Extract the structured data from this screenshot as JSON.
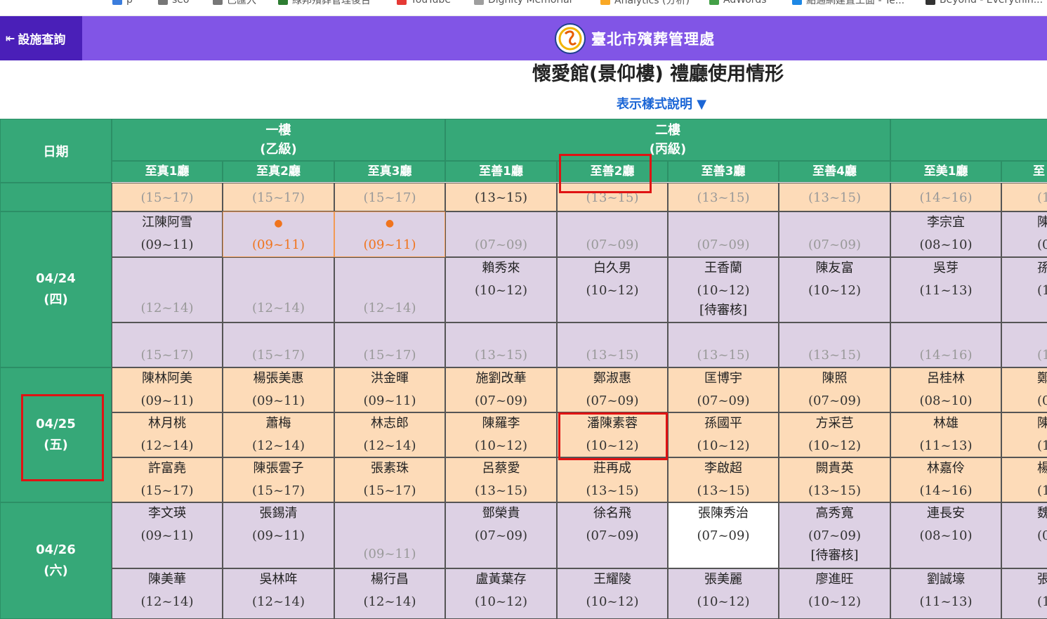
{
  "bookmarks": [
    {
      "label": "p",
      "color": "#3b7ddd"
    },
    {
      "label": "seo",
      "color": "#777777"
    },
    {
      "label": "已匯入",
      "color": "#777777"
    },
    {
      "label": "綠邦殯葬管理後台",
      "color": "#2e7d32"
    },
    {
      "label": "YouTube",
      "color": "#e53935"
    },
    {
      "label": "Dignity Memorial",
      "color": "#9e9e9e"
    },
    {
      "label": "Analytics (分析)",
      "color": "#f9a825"
    },
    {
      "label": "AdWords",
      "color": "#43a047"
    },
    {
      "label": "點通網建置工面 - Te...",
      "color": "#1e88e5"
    },
    {
      "label": "Beyond - Everythin...",
      "color": "#333333"
    }
  ],
  "header": {
    "back_label": "設施查詢",
    "back_icon": "back-arrow-icon",
    "brand": "臺北市殯葬管理處",
    "logo_icon": "agency-logo-icon"
  },
  "page": {
    "title": "懷愛館(景仰樓) 禮廳使用情形",
    "legend_toggle": "表示樣式說明 ▼"
  },
  "table": {
    "date_header": "日期",
    "floors": [
      {
        "label": "一樓",
        "sub": "(乙級)"
      },
      {
        "label": "二樓",
        "sub": "(丙級)"
      }
    ],
    "halls": [
      "至真1廳",
      "至真2廳",
      "至真3廳",
      "至善1廳",
      "至善2廳",
      "至善3廳",
      "至善4廳",
      "至美1廳",
      "至"
    ],
    "dates": [
      {
        "date": "04/24",
        "weekday": "(四)"
      },
      {
        "date": "04/25",
        "weekday": "(五)"
      },
      {
        "date": "04/26",
        "weekday": "(六)"
      }
    ],
    "rows": [
      {
        "cells": [
          {
            "time": "(15~17)",
            "state": "avail",
            "bg": "orange"
          },
          {
            "time": "(15~17)",
            "state": "avail",
            "bg": "orange"
          },
          {
            "time": "(15~17)",
            "state": "avail",
            "bg": "orange"
          },
          {
            "time": "(13~15)",
            "bg": "orange"
          },
          {
            "time": "(13~15)",
            "state": "avail",
            "bg": "orange"
          },
          {
            "time": "(13~15)",
            "state": "avail",
            "bg": "orange"
          },
          {
            "time": "(13~15)",
            "state": "avail",
            "bg": "orange"
          },
          {
            "time": "(14~16)",
            "state": "avail",
            "bg": "orange"
          },
          {
            "time": "(1",
            "state": "avail",
            "bg": "orange"
          }
        ]
      },
      {
        "cells": [
          {
            "name": "江陳阿雪",
            "time": "(09~11)",
            "bg": "lilac"
          },
          {
            "time": "(09~11)",
            "state": "sel",
            "bg": "sel"
          },
          {
            "time": "(09~11)",
            "state": "sel",
            "bg": "sel"
          },
          {
            "time": "(07~09)",
            "state": "avail",
            "bg": "lilac"
          },
          {
            "time": "(07~09)",
            "state": "avail",
            "bg": "lilac"
          },
          {
            "time": "(07~09)",
            "state": "avail",
            "bg": "lilac"
          },
          {
            "time": "(07~09)",
            "state": "avail",
            "bg": "lilac"
          },
          {
            "name": "李宗宜",
            "time": "(08~10)",
            "bg": "lilac"
          },
          {
            "name": "陳",
            "time": "(0",
            "bg": "lilac"
          }
        ]
      },
      {
        "cells": [
          {
            "time": "(12~14)",
            "state": "avail",
            "bg": "lilac"
          },
          {
            "time": "(12~14)",
            "state": "avail",
            "bg": "lilac"
          },
          {
            "time": "(12~14)",
            "state": "avail",
            "bg": "lilac"
          },
          {
            "name": "賴秀來",
            "time": "(10~12)",
            "bg": "lilac"
          },
          {
            "name": "白久男",
            "time": "(10~12)",
            "bg": "lilac"
          },
          {
            "name": "王香蘭",
            "time": "(10~12)",
            "status": "[待審核]",
            "bg": "lilac"
          },
          {
            "name": "陳友富",
            "time": "(10~12)",
            "bg": "lilac"
          },
          {
            "name": "吳芽",
            "time": "(11~13)",
            "bg": "lilac"
          },
          {
            "name": "孫",
            "time": "(1",
            "bg": "lilac"
          }
        ]
      },
      {
        "cells": [
          {
            "time": "(15~17)",
            "state": "avail",
            "bg": "lilac"
          },
          {
            "time": "(15~17)",
            "state": "avail",
            "bg": "lilac"
          },
          {
            "time": "(15~17)",
            "state": "avail",
            "bg": "lilac"
          },
          {
            "time": "(13~15)",
            "state": "avail",
            "bg": "lilac"
          },
          {
            "time": "(13~15)",
            "state": "avail",
            "bg": "lilac"
          },
          {
            "time": "(13~15)",
            "state": "avail",
            "bg": "lilac"
          },
          {
            "time": "(13~15)",
            "state": "avail",
            "bg": "lilac"
          },
          {
            "time": "(14~16)",
            "state": "avail",
            "bg": "lilac"
          },
          {
            "time": "(1",
            "state": "avail",
            "bg": "lilac"
          }
        ]
      },
      {
        "cells": [
          {
            "name": "陳林阿美",
            "time": "(09~11)",
            "bg": "orange"
          },
          {
            "name": "楊張美惠",
            "time": "(09~11)",
            "bg": "orange"
          },
          {
            "name": "洪金暉",
            "time": "(09~11)",
            "bg": "orange"
          },
          {
            "name": "施劉改華",
            "time": "(07~09)",
            "bg": "orange"
          },
          {
            "name": "鄭淑惠",
            "time": "(07~09)",
            "bg": "orange"
          },
          {
            "name": "匡博宇",
            "time": "(07~09)",
            "bg": "orange"
          },
          {
            "name": "陳照",
            "time": "(07~09)",
            "bg": "orange"
          },
          {
            "name": "呂桂林",
            "time": "(08~10)",
            "bg": "orange"
          },
          {
            "name": "鄭",
            "time": "(0",
            "bg": "orange"
          }
        ]
      },
      {
        "cells": [
          {
            "name": "林月桃",
            "time": "(12~14)",
            "bg": "orange"
          },
          {
            "name": "蕭梅",
            "time": "(12~14)",
            "bg": "orange"
          },
          {
            "name": "林志郎",
            "time": "(12~14)",
            "bg": "orange"
          },
          {
            "name": "陳羅李",
            "time": "(10~12)",
            "bg": "orange"
          },
          {
            "name": "潘陳素蓉",
            "time": "(10~12)",
            "bg": "orange"
          },
          {
            "name": "孫國平",
            "time": "(10~12)",
            "bg": "orange"
          },
          {
            "name": "方采芑",
            "time": "(10~12)",
            "bg": "orange"
          },
          {
            "name": "林雄",
            "time": "(11~13)",
            "bg": "orange"
          },
          {
            "name": "陳",
            "time": "(1",
            "bg": "orange"
          }
        ]
      },
      {
        "cells": [
          {
            "name": "許富堯",
            "time": "(15~17)",
            "bg": "orange"
          },
          {
            "name": "陳張雲子",
            "time": "(15~17)",
            "bg": "orange"
          },
          {
            "name": "張素珠",
            "time": "(15~17)",
            "bg": "orange"
          },
          {
            "name": "呂蔡愛",
            "time": "(13~15)",
            "bg": "orange"
          },
          {
            "name": "莊再成",
            "time": "(13~15)",
            "bg": "orange"
          },
          {
            "name": "李啟超",
            "time": "(13~15)",
            "bg": "orange"
          },
          {
            "name": "闕貴英",
            "time": "(13~15)",
            "bg": "orange"
          },
          {
            "name": "林嘉伶",
            "time": "(14~16)",
            "bg": "orange"
          },
          {
            "name": "楊",
            "time": "(1",
            "bg": "orange"
          }
        ]
      },
      {
        "cells": [
          {
            "name": "李文瑛",
            "time": "(09~11)",
            "bg": "lilac"
          },
          {
            "name": "張錫清",
            "time": "(09~11)",
            "bg": "lilac"
          },
          {
            "time": "(09~11)",
            "state": "avail",
            "bg": "lilac"
          },
          {
            "name": "鄧榮貴",
            "time": "(07~09)",
            "bg": "lilac"
          },
          {
            "name": "徐名飛",
            "time": "(07~09)",
            "bg": "lilac"
          },
          {
            "name": "張陳秀治",
            "time": "(07~09)",
            "bg": "white"
          },
          {
            "name": "高秀寬",
            "time": "(07~09)",
            "status": "[待審核]",
            "bg": "lilac"
          },
          {
            "name": "連長安",
            "time": "(08~10)",
            "bg": "lilac"
          },
          {
            "name": "魏",
            "time": "(0",
            "bg": "lilac"
          }
        ]
      },
      {
        "cells": [
          {
            "name": "陳美華",
            "time": "(12~14)",
            "bg": "lilac"
          },
          {
            "name": "吳林哖",
            "time": "(12~14)",
            "bg": "lilac"
          },
          {
            "name": "楊行昌",
            "time": "(12~14)",
            "bg": "lilac"
          },
          {
            "name": "盧黃葉存",
            "time": "(10~12)",
            "bg": "lilac"
          },
          {
            "name": "王耀陵",
            "time": "(10~12)",
            "bg": "lilac"
          },
          {
            "name": "張美麗",
            "time": "(10~12)",
            "bg": "lilac"
          },
          {
            "name": "廖進旺",
            "time": "(10~12)",
            "bg": "lilac"
          },
          {
            "name": "劉誠壕",
            "time": "(11~13)",
            "bg": "lilac"
          },
          {
            "name": "張",
            "time": "(1",
            "bg": "lilac"
          }
        ]
      }
    ]
  },
  "colors": {
    "header_purple": "#8155e6",
    "back_button": "#4a1fb8",
    "table_green": "#36a878",
    "cell_orange": "#fddbb8",
    "cell_lilac": "#ddd1e4",
    "selected_text": "#f0741d",
    "highlight_red": "#e01313",
    "link_blue": "#1b66d6"
  }
}
